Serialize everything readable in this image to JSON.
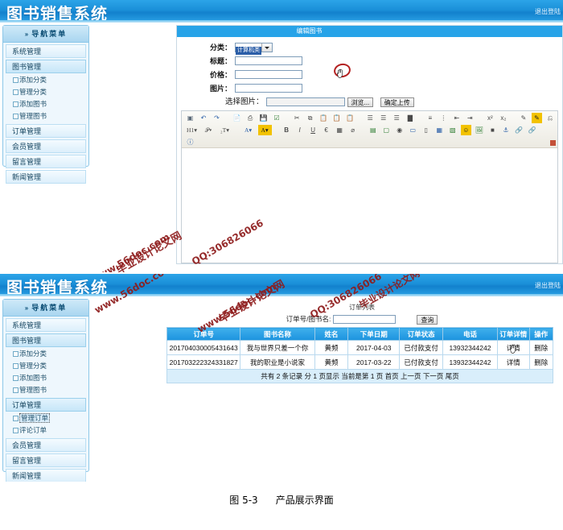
{
  "app": {
    "title": "图书销售系统",
    "logout_label": "退出登陆",
    "accent_color": "#1d93de",
    "header_gradient_from": "#2ca4e8",
    "header_gradient_to": "#1281cd"
  },
  "sidebar": {
    "nav_header": "导航菜单",
    "chevron_icon": "»",
    "items_top": [
      {
        "label": "系统管理",
        "active": false
      },
      {
        "label": "图书管理",
        "active": true
      },
      {
        "label": "订单管理",
        "active": false
      },
      {
        "label": "会员管理",
        "active": false
      },
      {
        "label": "留言管理",
        "active": false
      },
      {
        "label": "新闻管理",
        "active": false
      }
    ],
    "book_subitems": [
      {
        "label": "添加分类"
      },
      {
        "label": "管理分类"
      },
      {
        "label": "添加图书"
      },
      {
        "label": "管理图书"
      }
    ],
    "order_subitems": [
      {
        "label": "管理订单",
        "selected": true
      },
      {
        "label": "评论订单",
        "selected": false
      }
    ]
  },
  "edit_book": {
    "panel_title": "编辑图书",
    "fields": [
      {
        "label": "分类：",
        "type": "select",
        "value": "计算机类"
      },
      {
        "label": "标题：",
        "type": "text",
        "value": ""
      },
      {
        "label": "价格：",
        "type": "text",
        "value": ""
      },
      {
        "label": "图片：",
        "type": "text",
        "value": ""
      }
    ],
    "upload": {
      "label": "选择图片：",
      "file_value": "",
      "browse_label": "浏览...",
      "confirm_label": "确定上传"
    },
    "editor": {
      "toolbar_row1": [
        "source-icon",
        "undo-icon",
        "redo-icon",
        "sep",
        "preview-icon",
        "print-icon",
        "save-icon",
        "spellcheck-icon",
        "sep",
        "cut-icon",
        "copy-icon",
        "paste-icon",
        "paste-text-icon",
        "paste-word-icon",
        "sep",
        "align-left-icon",
        "align-center-icon",
        "align-right-icon",
        "align-justify-icon",
        "sep",
        "numbered-list-icon",
        "bulleted-list-icon",
        "outdent-icon",
        "indent-icon",
        "sep",
        "superscript-icon",
        "subscript-icon",
        "sep",
        "pencil-icon",
        "highlighter-icon",
        "eraser-icon"
      ],
      "toolbar_row2": [
        "heading-select",
        "font-select",
        "fontsize-select",
        "sep",
        "text-color-icon",
        "bg-color-icon",
        "sep",
        "bold-icon",
        "italic-icon",
        "underline-icon",
        "strikethrough-icon",
        "grid-icon",
        "remove-format-icon",
        "sep",
        "form-icon",
        "checkbox-icon",
        "radio-icon",
        "textfield-icon",
        "button-icon",
        "table-icon",
        "insert-row-icon",
        "emoticon-icon",
        "image-icon",
        "flash-icon",
        "anchor-icon",
        "link-icon",
        "unlink-icon"
      ],
      "toolbar_row3": [
        "about-icon"
      ],
      "content": ""
    }
  },
  "order_list": {
    "panel_title": "订单列表",
    "search": {
      "label": "订单号/图书名:",
      "value": "",
      "placeholder": "",
      "button_label": "查询"
    },
    "columns": [
      "订单号",
      "图书名称",
      "姓名",
      "下单日期",
      "订单状态",
      "电话",
      "订单详情",
      "操作"
    ],
    "rows": [
      {
        "order_no": "201704030005431643",
        "book_name": "我与世界只差一个你",
        "customer": "黄频",
        "order_date": "2017-04-03",
        "status": "已付款支付",
        "phone": "13932344242",
        "detail_label": "详情",
        "action_label": "删除"
      },
      {
        "order_no": "201703222324331827",
        "book_name": "我的职业是小说家",
        "customer": "黄频",
        "order_date": "2017-03-22",
        "status": "已付款支付",
        "phone": "13932344242",
        "detail_label": "详情",
        "action_label": "删除"
      }
    ],
    "footer": "共有 2 条记录  分 1 页显示   当前是第 1 页 首页 上一页 下一页 尾页"
  },
  "watermark": {
    "site_cn": "毕业设计论文网",
    "site_url": "www.56doc.com",
    "qq": "QQ:306826066"
  },
  "caption": {
    "figure_no": "图 5-3",
    "figure_title": "产品展示界面"
  }
}
